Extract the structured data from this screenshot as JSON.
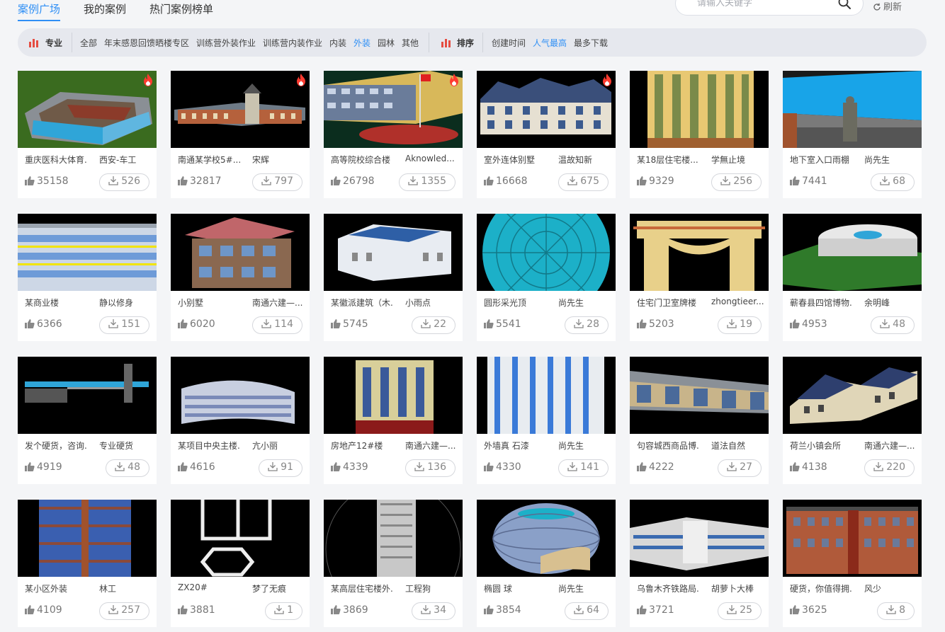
{
  "tabs": [
    {
      "label": "案例广场",
      "active": true
    },
    {
      "label": "我的案例",
      "active": false
    },
    {
      "label": "热门案例榜单",
      "active": false
    }
  ],
  "search": {
    "placeholder": "请输入关键字",
    "icon": "search-icon"
  },
  "refresh_label": "刷新",
  "filter": {
    "specialty_label": "专业",
    "specialty_options": [
      {
        "label": "全部",
        "active": false
      },
      {
        "label": "年末感恩回馈晒楼专区",
        "active": false
      },
      {
        "label": "训练营外装作业",
        "active": false
      },
      {
        "label": "训练营内装作业",
        "active": false
      },
      {
        "label": "内装",
        "active": false
      },
      {
        "label": "外装",
        "active": true
      },
      {
        "label": "园林",
        "active": false
      },
      {
        "label": "其他",
        "active": false
      }
    ],
    "sort_label": "排序",
    "sort_options": [
      {
        "label": "创建时间",
        "active": false
      },
      {
        "label": "人气最高",
        "active": true
      },
      {
        "label": "最多下载",
        "active": false
      }
    ]
  },
  "colors": {
    "accent": "#2f8ff5",
    "hot": "#ff3b30"
  },
  "cards": [
    {
      "title": "重庆医科大体育.",
      "author": "西安-车工",
      "likes": "35158",
      "downloads": "526",
      "hot": true
    },
    {
      "title": "南通某学校5#...",
      "author": "宋辉",
      "likes": "32817",
      "downloads": "797",
      "hot": true
    },
    {
      "title": "高等院校综合楼",
      "author": "Aknowled...",
      "likes": "26798",
      "downloads": "1355",
      "hot": true
    },
    {
      "title": "室外连体别墅",
      "author": "温故知新",
      "likes": "16668",
      "downloads": "675",
      "hot": true
    },
    {
      "title": "某18层住宅楼...",
      "author": "学無止境",
      "likes": "9329",
      "downloads": "256",
      "hot": false
    },
    {
      "title": "地下室入口雨棚",
      "author": "尚先生",
      "likes": "7441",
      "downloads": "68",
      "hot": false
    },
    {
      "title": "某商业楼",
      "author": "静以修身",
      "likes": "6366",
      "downloads": "151",
      "hot": false
    },
    {
      "title": "小别墅",
      "author": "南通六建—...",
      "likes": "6020",
      "downloads": "114",
      "hot": false
    },
    {
      "title": "某徽派建筑（木.",
      "author": "小雨点",
      "likes": "5745",
      "downloads": "22",
      "hot": false
    },
    {
      "title": "圆形采光顶",
      "author": "尚先生",
      "likes": "5541",
      "downloads": "28",
      "hot": false
    },
    {
      "title": "住宅门卫室牌楼",
      "author": "zhongtieer...",
      "likes": "5203",
      "downloads": "19",
      "hot": false
    },
    {
      "title": "蕲春县四馆博物.",
      "author": "余明峰",
      "likes": "4953",
      "downloads": "48",
      "hot": false
    },
    {
      "title": "发个硬货，咨询.",
      "author": "专业硬货",
      "likes": "4919",
      "downloads": "48",
      "hot": false
    },
    {
      "title": "某项目中央主楼.",
      "author": "亢小丽",
      "likes": "4616",
      "downloads": "91",
      "hot": false
    },
    {
      "title": "房地产12#楼",
      "author": "南通六建—...",
      "likes": "4339",
      "downloads": "136",
      "hot": false
    },
    {
      "title": "外墙真 石漆",
      "author": "尚先生",
      "likes": "4330",
      "downloads": "141",
      "hot": false
    },
    {
      "title": "句容城西商品博.",
      "author": "道法自然",
      "likes": "4222",
      "downloads": "27",
      "hot": false
    },
    {
      "title": "荷兰小镇会所",
      "author": "南通六建—...",
      "likes": "4138",
      "downloads": "220",
      "hot": false
    },
    {
      "title": "某小区外装",
      "author": "林工",
      "likes": "4109",
      "downloads": "257",
      "hot": false
    },
    {
      "title": "ZX20#",
      "author": "梦了无痕",
      "likes": "3881",
      "downloads": "1",
      "hot": false
    },
    {
      "title": "某高层住宅楼外.",
      "author": "工程狗",
      "likes": "3869",
      "downloads": "34",
      "hot": false
    },
    {
      "title": "椭圆 球",
      "author": "尚先生",
      "likes": "3854",
      "downloads": "64",
      "hot": false
    },
    {
      "title": "乌鲁木齐铁路局.",
      "author": "胡萝卜大棒",
      "likes": "3721",
      "downloads": "25",
      "hot": false
    },
    {
      "title": "硬货，你值得拥.",
      "author": "风少",
      "likes": "3625",
      "downloads": "8",
      "hot": false
    }
  ]
}
